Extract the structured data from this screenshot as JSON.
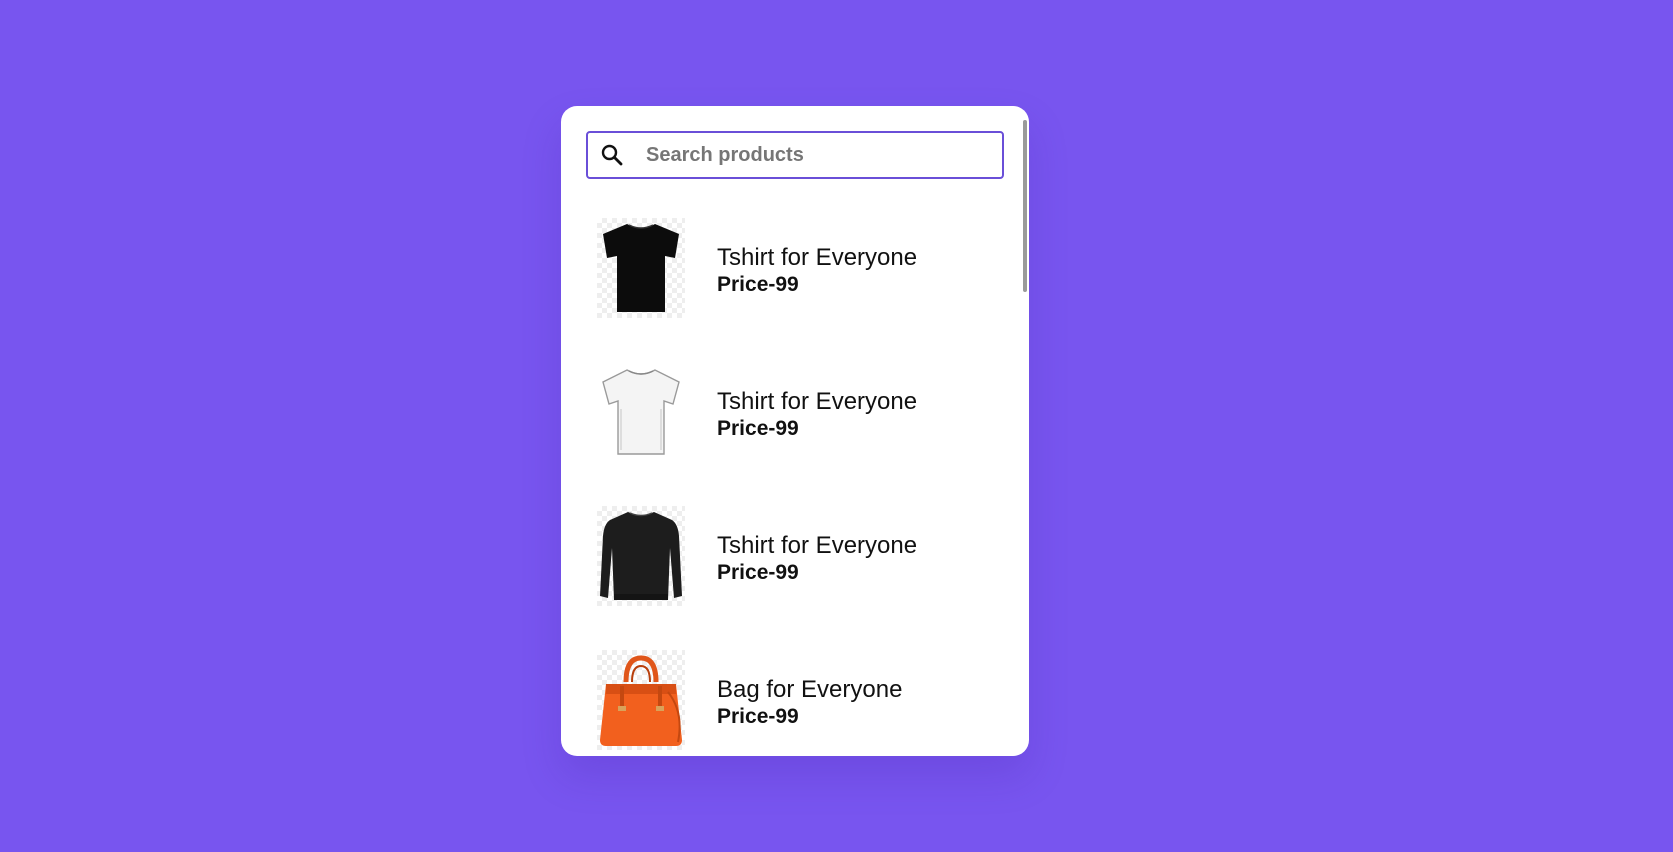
{
  "colors": {
    "background": "#7855ef",
    "card": "#ffffff",
    "search_border": "#6a4fd8",
    "text": "#111111"
  },
  "search": {
    "placeholder": "Search products",
    "value": "",
    "icon": "search-icon"
  },
  "products": [
    {
      "title": "Tshirt for Everyone",
      "price": "Price-99",
      "image": "black-tshirt-image"
    },
    {
      "title": "Tshirt for Everyone",
      "price": "Price-99",
      "image": "white-tshirt-image"
    },
    {
      "title": "Tshirt for Everyone",
      "price": "Price-99",
      "image": "black-sweatshirt-image"
    },
    {
      "title": "Bag for Everyone",
      "price": "Price-99",
      "image": "orange-handbag-image"
    }
  ]
}
